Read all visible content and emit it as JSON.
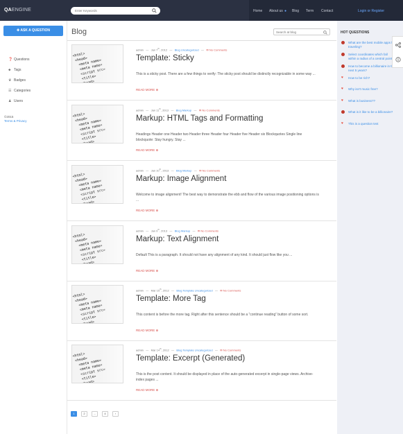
{
  "header": {
    "logo_bold": "QA",
    "logo_rest": "ENGINE",
    "search_placeholder": "Enter Keywords",
    "nav": [
      "Home",
      "About us",
      "Blog",
      "Term",
      "Contact"
    ],
    "login": "Login or Register"
  },
  "sidebar": {
    "ask_button": "ASK A QUESTION",
    "items": [
      {
        "label": "Questions",
        "icon": "question-icon"
      },
      {
        "label": "Tags",
        "icon": "tag-icon"
      },
      {
        "label": "Badges",
        "icon": "trophy-icon"
      },
      {
        "label": "Categories",
        "icon": "list-icon"
      },
      {
        "label": "Users",
        "icon": "users-icon"
      }
    ],
    "copyright_year": "©2015",
    "copyright_link": "Terms & Privacy"
  },
  "blog": {
    "title": "Blog",
    "search_placeholder": "Search at blog"
  },
  "posts": [
    {
      "author": "admin",
      "date": "Jan 7",
      "date_sup": "th",
      "year": ", 2012",
      "category": "Blog Uncategorized",
      "comments": "No Comments",
      "title": "Template: Sticky",
      "excerpt": "This is a sticky post. There are a few things to verify: The sticky post should be distinctly recognizable in some way ...",
      "readmore": "READ MORE"
    },
    {
      "author": "admin",
      "date": "Jan 11",
      "date_sup": "th",
      "year": ", 2013",
      "category": "Blog Markup",
      "comments": "No Comments",
      "title": "Markup: HTML Tags and Formatting",
      "excerpt": "Headings Header one Header two Header three Header four Header five Header six Blockquotes Single line blockquote: Stay hungry. Stay ...",
      "readmore": "READ MORE"
    },
    {
      "author": "admin",
      "date": "Jan 10",
      "date_sup": "th",
      "year": ", 2013",
      "category": "Blog Markup",
      "comments": "No Comments",
      "title": "Markup: Image Alignment",
      "excerpt": "Welcome to image alignment! The best way to demonstrate the ebb and flow of the various image positioning options is ...",
      "readmore": "READ MORE"
    },
    {
      "author": "admin",
      "date": "Jan 9",
      "date_sup": "th",
      "year": ", 2013",
      "category": "Blog Markup",
      "comments": "No Comments",
      "title": "Markup: Text Alignment",
      "excerpt": "Default This is a paragraph. It should not have any alignment of any kind. It should just flow like you ...",
      "readmore": "READ MORE"
    },
    {
      "author": "admin",
      "date": "Mar 15",
      "date_sup": "th",
      "year": ", 2012",
      "category": "Blog Template Uncategorized",
      "comments": "No Comments",
      "title": "Template: More Tag",
      "excerpt": "This content is before the more tag. Right after this sentence should be a “continue reading” button of some sort.",
      "readmore": "READ MORE"
    },
    {
      "author": "admin",
      "date": "Mar 14",
      "date_sup": "th",
      "year": ", 2012",
      "category": "Blog Template Uncategorized",
      "comments": "No Comments",
      "title": "Template: Excerpt (Generated)",
      "excerpt": "This is the post content. It should be displayed in place of the auto-generated excerpt in single-page views. Archive-index pages ...",
      "readmore": "READ MORE"
    }
  ],
  "pagination": [
    "1",
    "2",
    "...",
    "4",
    "›"
  ],
  "hot_questions": {
    "title": "HOT QUESTIONS",
    "items": [
      {
        "text": "What are the best mobile apps for traveling?",
        "avatar": "#c0392b"
      },
      {
        "text": "Select coordinates which fall within a radius of a central point?",
        "avatar": "#c0392b"
      },
      {
        "text": "How to become a billionaire in the next 5 years?",
        "avatar": "#c0392b"
      },
      {
        "text": "How to be rich?",
        "avatar": "#e74c3c"
      },
      {
        "text": "Why isn't music free?",
        "avatar": "#e74c3c"
      },
      {
        "text": "What is business??",
        "avatar": "#e74c3c"
      },
      {
        "text": "What is it like to be a billionaire?",
        "avatar": "#c0392b"
      },
      {
        "text": "This is a question test",
        "avatar": "#e74c3c"
      }
    ]
  },
  "colors": {
    "topbar": "#2b3142",
    "accent": "#3a8ee6",
    "readmore": "#d9534f",
    "right_bg": "#eef0f6"
  }
}
